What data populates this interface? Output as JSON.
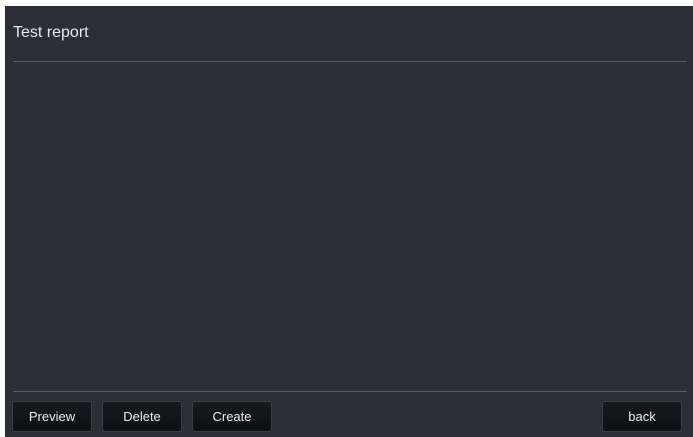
{
  "header": {
    "title": "Test report"
  },
  "toolbar": {
    "preview_label": "Preview",
    "delete_label": "Delete",
    "create_label": "Create",
    "back_label": "back"
  },
  "colors": {
    "background": "#2b2e35",
    "divider": "#5a5f68",
    "button": "#131518",
    "text": "#e8e9eb"
  }
}
